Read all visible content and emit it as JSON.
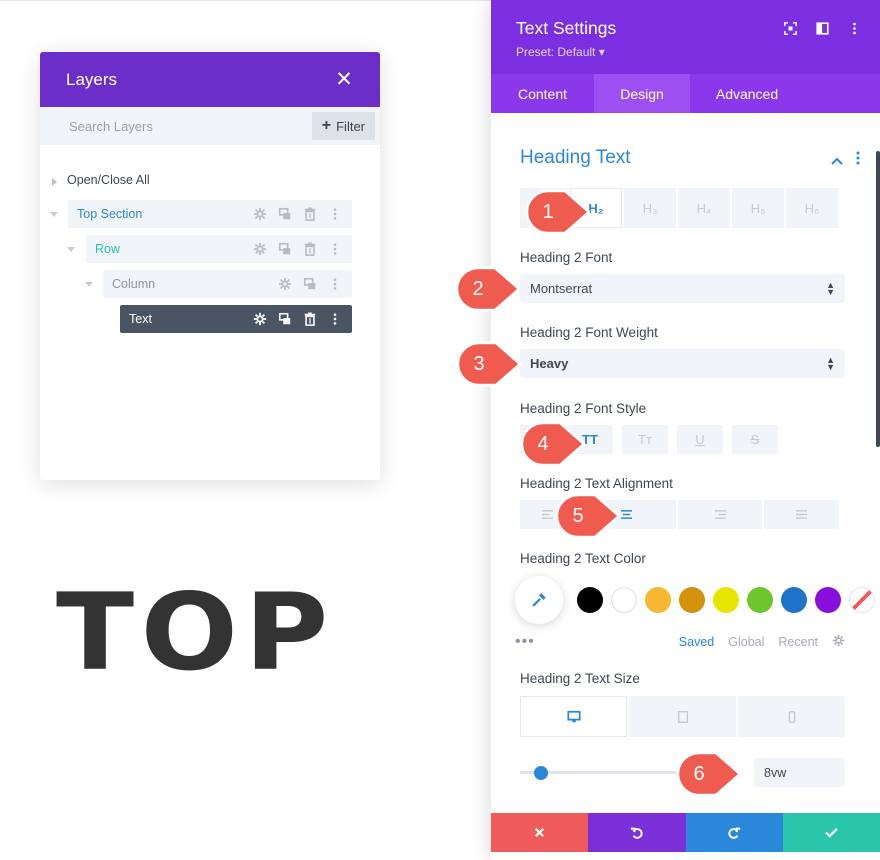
{
  "colors": {
    "layers_header": "#6c2ec9",
    "settings_header": "#7b2fe0",
    "tabs_bg": "#8b38ec",
    "tab_active": "#9d4ff1",
    "accent_blue": "#2b87da",
    "row_green": "#29c4a9",
    "text_node_bg": "#4a5563",
    "marker": "#ef5b4f",
    "footer_cancel": "#ef5b5b",
    "footer_undo": "#7b2fd6",
    "footer_redo": "#2b87da",
    "footer_save": "#29c4a9"
  },
  "layers": {
    "title": "Layers",
    "close_icon": "close-icon",
    "search_placeholder": "Search Layers",
    "filter_label": "Filter",
    "open_close_all": "Open/Close All",
    "tree": [
      {
        "label": "Top Section",
        "level": 0,
        "kind": "section"
      },
      {
        "label": "Row",
        "level": 1,
        "kind": "row"
      },
      {
        "label": "Column",
        "level": 2,
        "kind": "column"
      },
      {
        "label": "Text",
        "level": 3,
        "kind": "module",
        "selected": true
      }
    ]
  },
  "canvas": {
    "heading_text": "TOP"
  },
  "settings": {
    "title": "Text Settings",
    "preset": "Preset: Default ▾",
    "tabs": [
      {
        "label": "Content",
        "active": false
      },
      {
        "label": "Design",
        "active": true
      },
      {
        "label": "Advanced",
        "active": false
      }
    ],
    "section_title": "Heading Text",
    "heading_tabs": [
      "",
      "H₂",
      "H₃",
      "H₄",
      "H₅",
      "H₆"
    ],
    "heading_active_index": 1,
    "font_label": "Heading 2 Font",
    "font_value": "Montserrat",
    "weight_label": "Heading 2 Font Weight",
    "weight_value": "Heavy",
    "style_label": "Heading 2 Font Style",
    "style_buttons": [
      "",
      "TT",
      "Tт",
      "U",
      "S"
    ],
    "style_active_index": 1,
    "alignment_label": "Heading 2 Text Alignment",
    "alignment_buttons": [
      "",
      "center",
      "right",
      "justify"
    ],
    "alignment_active_index": 1,
    "color_label": "Heading 2 Text Color",
    "swatches": [
      "#000000",
      "#ffffff",
      "#f7b731",
      "#d4910c",
      "#e6e600",
      "#6cc72a",
      "#1f73c8",
      "#8a0fdf",
      "none"
    ],
    "color_tabs": {
      "saved": "Saved",
      "global": "Global",
      "recent": "Recent"
    },
    "size_label": "Heading 2 Text Size",
    "devices": [
      "desktop-icon",
      "tablet-icon",
      "phone-icon"
    ],
    "size_value": "8vw",
    "slider_fraction": 0.11
  },
  "markers": [
    "1",
    "2",
    "3",
    "4",
    "5",
    "6"
  ]
}
